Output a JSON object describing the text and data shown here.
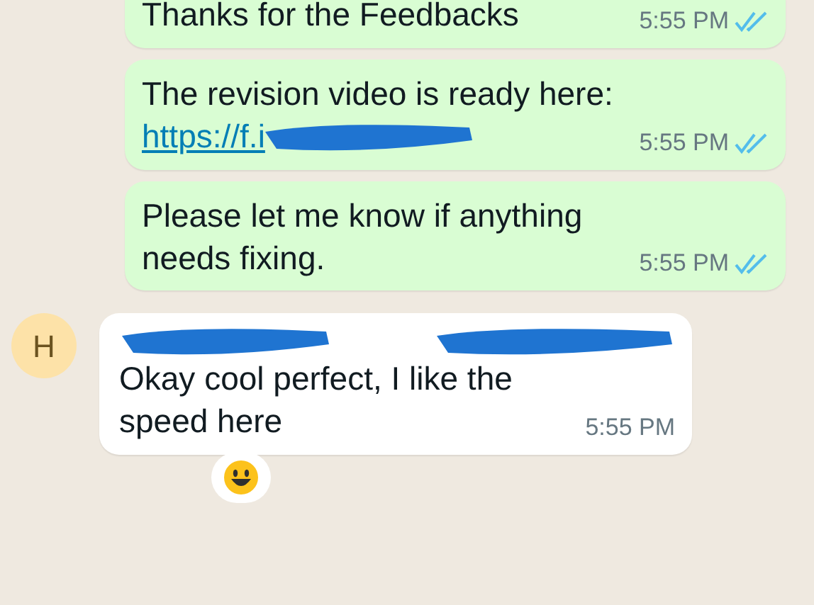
{
  "messages": [
    {
      "kind": "outgoing",
      "text": "Thanks for the Feedbacks",
      "time": "5:55 PM",
      "read": true
    },
    {
      "kind": "outgoing",
      "text": "The revision video is ready here:",
      "link": "https://f.i",
      "link_redacted": true,
      "time": "5:55 PM",
      "read": true
    },
    {
      "kind": "outgoing",
      "text": "Please let me know if anything needs fixing.",
      "time": "5:55 PM",
      "read": true
    },
    {
      "kind": "incoming",
      "avatar": "H",
      "sender_redacted": true,
      "text": "Okay cool perfect, I like the speed here",
      "time": "5:55 PM",
      "reaction": true
    }
  ]
}
